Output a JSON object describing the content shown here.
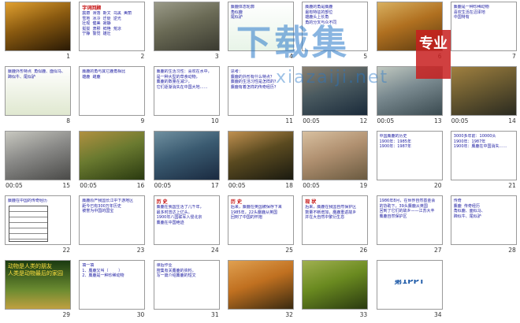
{
  "slides": [
    {
      "number": "1",
      "timing": "",
      "kind": "photo",
      "colors": [
        "#2a1a05",
        "#8a5a10",
        "#e0a030"
      ]
    },
    {
      "number": "2",
      "timing": "",
      "kind": "text",
      "title": "字词回顾",
      "text": "震撼  滑落  斯文  乌黑  美丽\n雪地  冰冷  迁徙  逆光\n壮观  健美  寂静\n挺拔  肃穆  鲜艳  荒凉\n宁静  警觉  雄壮",
      "colors": [
        "#ffffff",
        "#ffffff"
      ]
    },
    {
      "number": "3",
      "timing": "",
      "kind": "photo",
      "colors": [
        "#3a3a30",
        "#6a6a55",
        "#9a9a88"
      ]
    },
    {
      "number": "4",
      "timing": "",
      "kind": "photo-text",
      "text": "麋鹿体态轮廓\n角似鹿\n尾似驴",
      "colors": [
        "#ffffff",
        "#e8f4e8"
      ]
    },
    {
      "number": "5",
      "timing": "",
      "kind": "text",
      "text": "麋鹿的角是麋鹿\n最有特征的部位\n雄鹿头上长角\n角的分叉与众不同",
      "colors": [
        "#ffffff",
        "#ffffff"
      ]
    },
    {
      "number": "6",
      "timing": "",
      "kind": "photo",
      "colors": [
        "#5a3a10",
        "#b07020",
        "#d8b060"
      ]
    },
    {
      "number": "7",
      "timing": "",
      "kind": "text",
      "text": "麋鹿是一种珍稀动物\n喜欢生活在沼泽地\n中国特有",
      "colors": [
        "#ffffff",
        "#f5f0e0"
      ]
    },
    {
      "number": "8",
      "timing": "",
      "kind": "photo-text",
      "text": "麋鹿外形特点  角似鹿、面似马、蹄似牛、尾似驴",
      "colors": [
        "#ffffff",
        "#e0e8d0"
      ]
    },
    {
      "number": "9",
      "timing": "",
      "kind": "photo-text",
      "text": "麋鹿的角与其它鹿角相比\n雄鹿  雌鹿",
      "colors": [
        "#ffffff",
        "#ffffff"
      ]
    },
    {
      "number": "10",
      "timing": "",
      "kind": "text",
      "text": "麋鹿的生活习性：喜欢在水中，\n是一种大型的草食动物，\n麋鹿的数量在减少，\n它们逐渐消失在中国大地……",
      "colors": [
        "#ffffff",
        "#ffffff"
      ]
    },
    {
      "number": "11",
      "timing": "",
      "kind": "text",
      "text": "思考：\n麋鹿的外形有什么特点？\n麋鹿的生活习性是怎样的？\n麋鹿有着怎样的传奇经历？",
      "colors": [
        "#ffffff",
        "#ffffff"
      ]
    },
    {
      "number": "12",
      "timing": "00:05",
      "kind": "photo",
      "colors": [
        "#1a2a3a",
        "#4a5a60",
        "#8a8070"
      ]
    },
    {
      "number": "13",
      "timing": "00:05",
      "kind": "photo",
      "colors": [
        "#3a4a50",
        "#7a8a90",
        "#c0c8c0"
      ]
    },
    {
      "number": "14",
      "timing": "00:05",
      "kind": "photo",
      "colors": [
        "#2a2a20",
        "#6a5a30",
        "#a08040"
      ]
    },
    {
      "number": "15",
      "timing": "00:05",
      "kind": "photo",
      "colors": [
        "#4a4a48",
        "#8a8a88",
        "#c8c8c0"
      ]
    },
    {
      "number": "16",
      "timing": "00:05",
      "kind": "photo",
      "colors": [
        "#2a3a10",
        "#6a7a30",
        "#b09040"
      ]
    },
    {
      "number": "17",
      "timing": "00:05",
      "kind": "photo",
      "colors": [
        "#1a2a40",
        "#3a5a70",
        "#7090a0"
      ]
    },
    {
      "number": "18",
      "timing": "00:05",
      "kind": "photo",
      "colors": [
        "#1a1a10",
        "#5a4a20",
        "#c09050"
      ]
    },
    {
      "number": "19",
      "timing": "00:05",
      "kind": "photo",
      "colors": [
        "#6a5a40",
        "#b09070",
        "#d8c0a0"
      ]
    },
    {
      "number": "20",
      "timing": "",
      "kind": "text",
      "text": "中国麋鹿的历史\n1900年：1985年\n1900年：1987年",
      "colors": [
        "#ffffff",
        "#ffffff"
      ]
    },
    {
      "number": "21",
      "timing": "",
      "kind": "text",
      "text": "3000多年前：10000头\n1900年：1987年\n1900年：麋鹿在中国消失……",
      "colors": [
        "#ffffff",
        "#ffffff"
      ]
    },
    {
      "number": "22",
      "timing": "",
      "kind": "table",
      "text": "麋鹿在中国的传奇经历",
      "colors": [
        "#ffffff",
        "#ffffff"
      ]
    },
    {
      "number": "23",
      "timing": "",
      "kind": "text",
      "text": "麋鹿原产我国长江中下游地区\n距今已有300万年历史\n被誉为中国的国宝",
      "colors": [
        "#ffffff",
        "#f0f0e8"
      ]
    },
    {
      "number": "24",
      "timing": "",
      "kind": "text",
      "title": "历 史",
      "text": "麋鹿在我国生活了几千年，\n最多时曾达上亿头。\n1900年八国联军入侵北京\n麋鹿在中国绝迹",
      "colors": [
        "#ffffff",
        "#ffffff"
      ]
    },
    {
      "number": "25",
      "timing": "",
      "kind": "text",
      "title": "历 史",
      "text": "后来，麋鹿在英国被保存下来\n1985年，22头麋鹿从英国\n回到了中国的怀抱",
      "colors": [
        "#ffffff",
        "#ffffff"
      ]
    },
    {
      "number": "26",
      "timing": "",
      "kind": "text",
      "title": "现 状",
      "text": "后来，麋鹿在我国自然保护区\n数量不断增加，麋鹿重返故乡\n并在大自然中繁衍生息",
      "colors": [
        "#ffffff",
        "#ffffff"
      ]
    },
    {
      "number": "27",
      "timing": "",
      "kind": "text",
      "text": "1986年8月，在世界自然基金会\n的协助下，39头麋鹿从英国\n回到了它们的故乡——江苏大丰\n麋鹿自然保护区",
      "colors": [
        "#ffffff",
        "#ffffff"
      ]
    },
    {
      "number": "28",
      "timing": "",
      "kind": "text",
      "text": "传奇\n麋鹿  传奇经历\n角似鹿、面似马、\n蹄似牛、尾似驴",
      "colors": [
        "#ffffff",
        "#ffffff"
      ]
    },
    {
      "number": "29",
      "timing": "",
      "kind": "photo-text",
      "text": "动物是人类的朋友\n人类是动物最后的家园",
      "colors": [
        "#1a3a10",
        "#6a8a30",
        "#c0a040"
      ]
    },
    {
      "number": "30",
      "timing": "",
      "kind": "text",
      "text": "填一填\n1、麋鹿又叫（        ）\n2、麋鹿是一种珍稀动物",
      "colors": [
        "#ffffff",
        "#ffffff"
      ]
    },
    {
      "number": "31",
      "timing": "",
      "kind": "text",
      "text": "课后作业\n搜集有关麋鹿的资料，\n写一篇介绍麋鹿的短文",
      "colors": [
        "#ffffff",
        "#ffffff"
      ]
    },
    {
      "number": "32",
      "timing": "",
      "kind": "photo",
      "colors": [
        "#3a2a10",
        "#c07020",
        "#e0a050"
      ]
    },
    {
      "number": "33",
      "timing": "",
      "kind": "photo",
      "colors": [
        "#2a3a10",
        "#6a8a20",
        "#a0b050"
      ]
    },
    {
      "number": "34",
      "timing": "",
      "kind": "logo",
      "text": "第1PPT",
      "colors": [
        "#ffffff",
        "#ffffff"
      ]
    }
  ],
  "watermark": {
    "title": "下载集",
    "badge": "专业",
    "url": "xiazaiji.net"
  }
}
